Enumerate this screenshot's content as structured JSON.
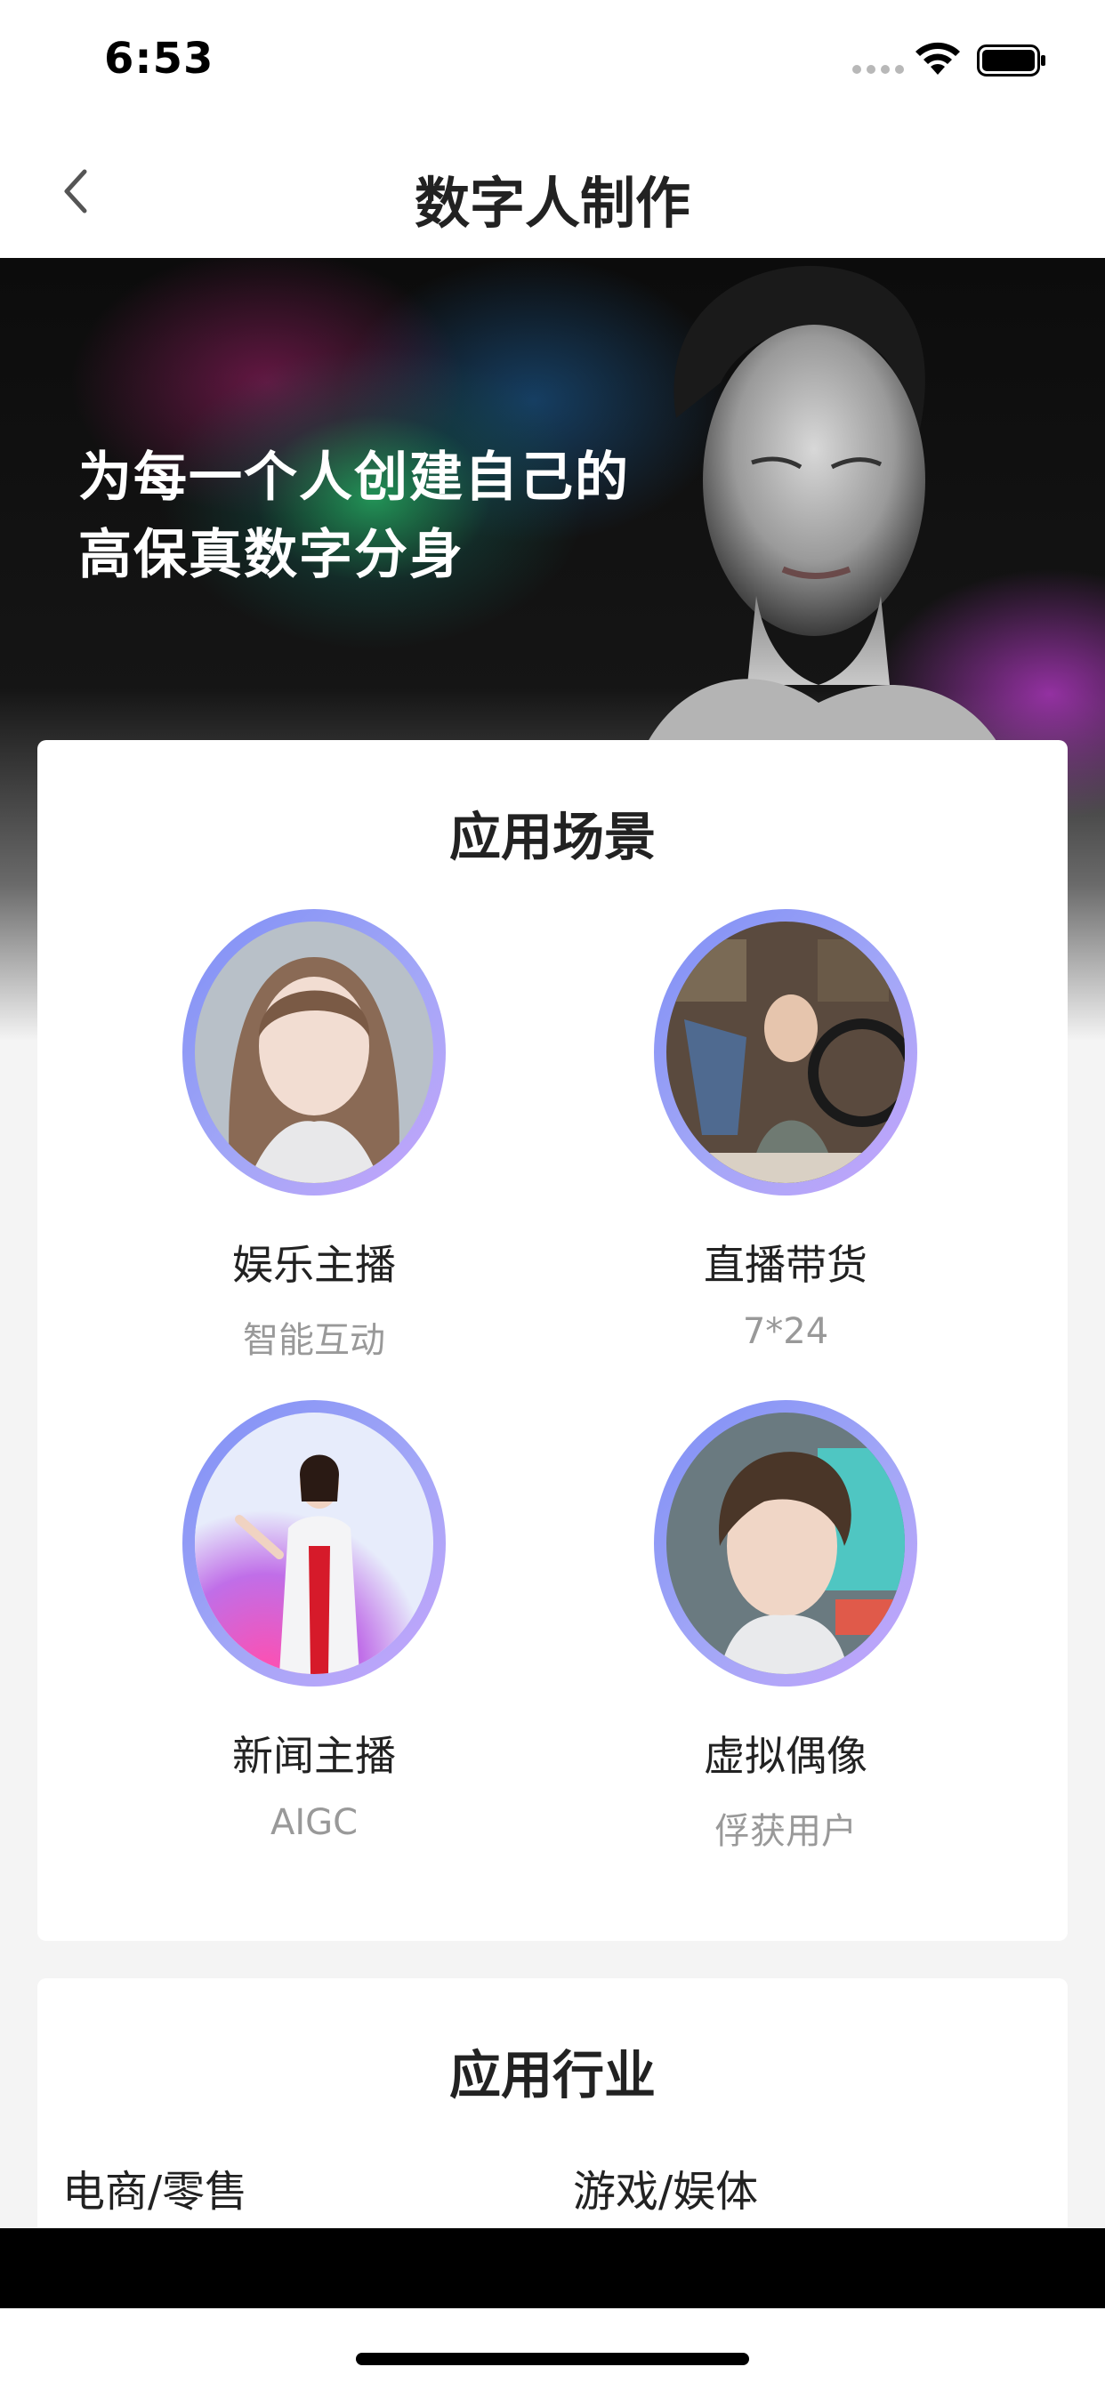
{
  "status_bar": {
    "time": "6:53"
  },
  "nav": {
    "title": "数字人制作"
  },
  "hero": {
    "line1": "为每一个人创建自己的",
    "line2": "高保真数字分身"
  },
  "scenarios": {
    "title": "应用场景",
    "items": [
      {
        "name": "娱乐主播",
        "sub": "智能互动"
      },
      {
        "name": "直播带货",
        "sub": "7*24"
      },
      {
        "name": "新闻主播",
        "sub": "AIGC"
      },
      {
        "name": "虚拟偶像",
        "sub": "俘获用户"
      }
    ]
  },
  "industries": {
    "title": "应用行业",
    "items": [
      "电商/零售",
      "游戏/娱体"
    ]
  },
  "colors": {
    "avatar_ring_start": "#7f8ff5",
    "avatar_ring_end": "#c6a4fb"
  }
}
